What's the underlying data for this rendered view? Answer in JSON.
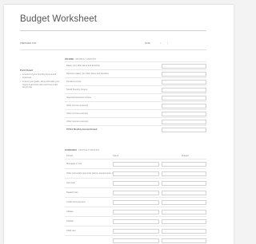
{
  "title": "Budget Worksheet",
  "header": {
    "prepared_for_label": "PREPARED FOR",
    "date_label": "DATE",
    "date_sep": "/"
  },
  "side_note": {
    "heading": "Put It Down!",
    "bullets": [
      "A record of your monthly income and expenses",
      "A list of your goals, along with what your hopes & and how often and how much they'll cost"
    ]
  },
  "income": {
    "heading": "INCOME",
    "subheading": "MONTHLY AMOUNT",
    "rows": [
      "Salary (net, after taxes and benefits)",
      "Spouse's salary (net, after taxes and benefits)",
      "Pension income",
      "Social Security income",
      "Interest/investment income",
      "Other income source(s)",
      "Other income source(s)",
      "Other income source(s)"
    ],
    "total_label": "TOTAL Monthly Income Earned"
  },
  "expenses": {
    "heading": "EXPENSES",
    "subheading": "MONTHLY AMOUNT",
    "columns": [
      "Period",
      "Spent",
      "Budget"
    ],
    "rows": [
      "Mortgage or rent",
      "Other real estate payments (taxes, assessments, etc.)",
      "Auto loan",
      "Student loan",
      "Credit card payment",
      "Utilities",
      "Cellular",
      "Child care",
      ""
    ]
  }
}
